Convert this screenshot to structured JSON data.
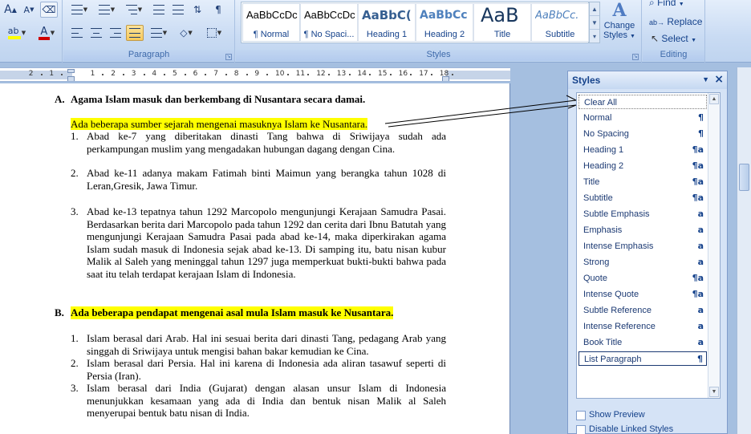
{
  "ribbon": {
    "font_sizes": {
      "grow": "A",
      "shrink": "A"
    },
    "paragraph_label": "Paragraph",
    "styles_label": "Styles",
    "editing_label": "Editing",
    "gallery": [
      {
        "preview": "AaBbCcDc",
        "name": "¶ Normal"
      },
      {
        "preview": "AaBbCcDc",
        "name": "¶ No Spaci..."
      },
      {
        "preview": "AaBbC(",
        "name": "Heading 1"
      },
      {
        "preview": "AaBbCc",
        "name": "Heading 2"
      },
      {
        "preview": "AaB",
        "name": "Title"
      },
      {
        "preview": "AaBbCc.",
        "name": "Subtitle"
      }
    ],
    "change_styles": {
      "line1": "Change",
      "line2": "Styles"
    },
    "editing": {
      "find": "Find",
      "replace": "Replace",
      "select": "Select"
    },
    "colors": {
      "highlight": "#ffff00",
      "font_color": "#d00000"
    }
  },
  "ruler": {
    "numbers": [
      "2",
      "1",
      "1",
      "2",
      "3",
      "4",
      "5",
      "6",
      "7",
      "8",
      "9",
      "10",
      "11",
      "12",
      "13",
      "14",
      "15",
      "16",
      "17",
      "18"
    ]
  },
  "document": {
    "heading_a_num": "A.",
    "heading_a": "Agama Islam masuk dan berkembang di Nusantara secara damai.",
    "intro": "Ada beberapa sumber sejarah mengenai masuknya Islam ke Nusantara.",
    "list_a": [
      {
        "num": "1.",
        "text": "Abad ke-7 yang diberitakan dinasti Tang bahwa di Sriwijaya sudah ada perkampungan muslim yang mengadakan hubungan dagang dengan Cina."
      },
      {
        "num": "2.",
        "text": "Abad ke-11 adanya makam Fatimah binti Maimun yang berangka tahun 1028 di Leran,Gresik, Jawa Timur."
      },
      {
        "num": "3.",
        "text": "Abad ke-13 tepatnya tahun 1292 Marcopolo mengunjungi Kerajaan Samudra Pasai. Berdasarkan berita dari Marcopolo pada tahun 1292 dan cerita dari Ibnu Batutah yang mengunjungi Kerajaan Samudra Pasai pada abad ke-14, maka diperkirakan agama Islam sudah masuk di Indonesia sejak abad ke-13. Di samping itu, batu nisan kubur Malik al Saleh yang meninggal tahun 1297 juga memperkuat bukti-bukti bahwa pada saat itu telah terdapat kerajaan Islam di Indonesia."
      }
    ],
    "heading_b_num": "B.",
    "heading_b": "Ada beberapa pendapat mengenai asal mula Islam masuk ke Nusantara.",
    "list_b": [
      {
        "num": "1.",
        "text": "Islam berasal dari Arab. Hal ini sesuai berita dari dinasti Tang, pedagang Arab yang singgah di Sriwijaya untuk mengisi bahan bakar kemudian ke Cina."
      },
      {
        "num": "2.",
        "text": "Islam berasal dari Persia. Hal ini karena di Indonesia ada aliran tasawuf seperti di Persia (Iran)."
      },
      {
        "num": "3.",
        "text": "Islam berasal dari India (Gujarat) dengan alasan unsur Islam di Indonesia menunjukkan kesamaan yang ada di India dan bentuk nisan Malik al Saleh menyerupai bentuk batu nisan di India."
      }
    ]
  },
  "styles_pane": {
    "title": "Styles",
    "items": [
      {
        "name": "Clear All",
        "icon": ""
      },
      {
        "name": "Normal",
        "icon": "¶"
      },
      {
        "name": "No Spacing",
        "icon": "¶"
      },
      {
        "name": "Heading 1",
        "icon": "¶a"
      },
      {
        "name": "Heading 2",
        "icon": "¶a"
      },
      {
        "name": "Title",
        "icon": "¶a"
      },
      {
        "name": "Subtitle",
        "icon": "¶a"
      },
      {
        "name": "Subtle Emphasis",
        "icon": "a"
      },
      {
        "name": "Emphasis",
        "icon": "a"
      },
      {
        "name": "Intense Emphasis",
        "icon": "a"
      },
      {
        "name": "Strong",
        "icon": "a"
      },
      {
        "name": "Quote",
        "icon": "¶a"
      },
      {
        "name": "Intense Quote",
        "icon": "¶a"
      },
      {
        "name": "Subtle Reference",
        "icon": "a"
      },
      {
        "name": "Intense Reference",
        "icon": "a"
      },
      {
        "name": "Book Title",
        "icon": "a"
      },
      {
        "name": "List Paragraph",
        "icon": "¶"
      }
    ],
    "show_preview": "Show Preview",
    "disable_linked": "Disable Linked Styles"
  }
}
